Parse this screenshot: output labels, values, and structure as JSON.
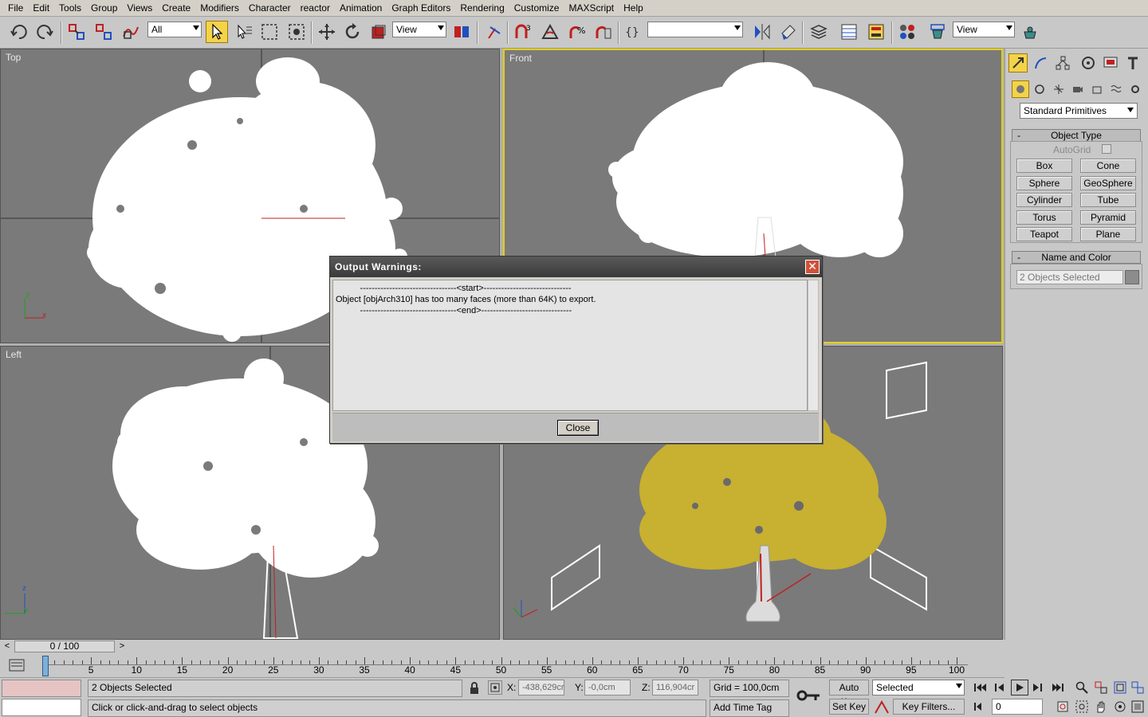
{
  "menubar": {
    "items": [
      "File",
      "Edit",
      "Tools",
      "Group",
      "Views",
      "Create",
      "Modifiers",
      "Character",
      "reactor",
      "Animation",
      "Graph Editors",
      "Rendering",
      "Customize",
      "MAXScript",
      "Help"
    ]
  },
  "toolbar": {
    "selection_filter": "All",
    "ref_coord": "View",
    "named_selection": "",
    "render_view": "View",
    "icons": [
      "undo-icon",
      "redo-icon",
      "select-link-icon",
      "unlink-icon",
      "bind-space-warp-icon",
      "select-object-icon",
      "select-by-name-icon",
      "rect-region-icon",
      "window-crossing-icon",
      "select-move-icon",
      "select-rotate-icon",
      "select-scale-icon",
      "pivot-icon",
      "manipulate-icon",
      "snap-3d-icon",
      "angle-snap-icon",
      "percent-snap-icon",
      "spinner-snap-icon",
      "edit-named-selection-icon",
      "mirror-icon",
      "align-icon",
      "layer-manager-icon",
      "curve-editor-icon",
      "schematic-view-icon",
      "material-editor-icon",
      "render-scene-icon",
      "quick-render-icon"
    ]
  },
  "viewports": {
    "top": {
      "label": "Top"
    },
    "front": {
      "label": "Front"
    },
    "left": {
      "label": "Left"
    },
    "perspective": {
      "label": ""
    }
  },
  "command_panel": {
    "category": "Standard Primitives",
    "object_type": {
      "header": "Object Type",
      "autogrid": "AutoGrid",
      "buttons": [
        "Box",
        "Cone",
        "Sphere",
        "GeoSphere",
        "Cylinder",
        "Tube",
        "Torus",
        "Pyramid",
        "Teapot",
        "Plane"
      ]
    },
    "name_color": {
      "header": "Name and Color",
      "name": "2 Objects Selected"
    }
  },
  "dialog": {
    "title": "Output Warnings:",
    "lines": [
      "          ---------------------------------<start>------------------------------",
      "Object [objArch310] has too many faces (more than 64K) to export.",
      "          ---------------------------------<end>-------------------------------"
    ],
    "close_label": "Close"
  },
  "time_slider": {
    "frame": "0 / 100",
    "ticks": [
      "0",
      "5",
      "10",
      "15",
      "20",
      "25",
      "30",
      "35",
      "40",
      "45",
      "50",
      "55",
      "60",
      "65",
      "70",
      "75",
      "80",
      "85",
      "90",
      "95",
      "100"
    ]
  },
  "status": {
    "selection": "2 Objects Selected",
    "prompt": "Click or click-and-drag to select objects",
    "x": "-438,629cr",
    "y": "-0,0cm",
    "z": "116,904cr",
    "x_label": "X:",
    "y_label": "Y:",
    "z_label": "Z:",
    "grid": "Grid = 100,0cm",
    "add_time_tag": "Add Time Tag",
    "auto_key": "Auto Key",
    "set_key": "Set Key",
    "key_mode": "Selected",
    "key_filters": "Key Filters...",
    "current_frame": "0"
  },
  "colors": {
    "active_viewport": "#e6d000",
    "foliage_wire": "#ffffff",
    "foliage_shaded": "#d2b830",
    "viewport_bg": "#7a7a7a"
  }
}
